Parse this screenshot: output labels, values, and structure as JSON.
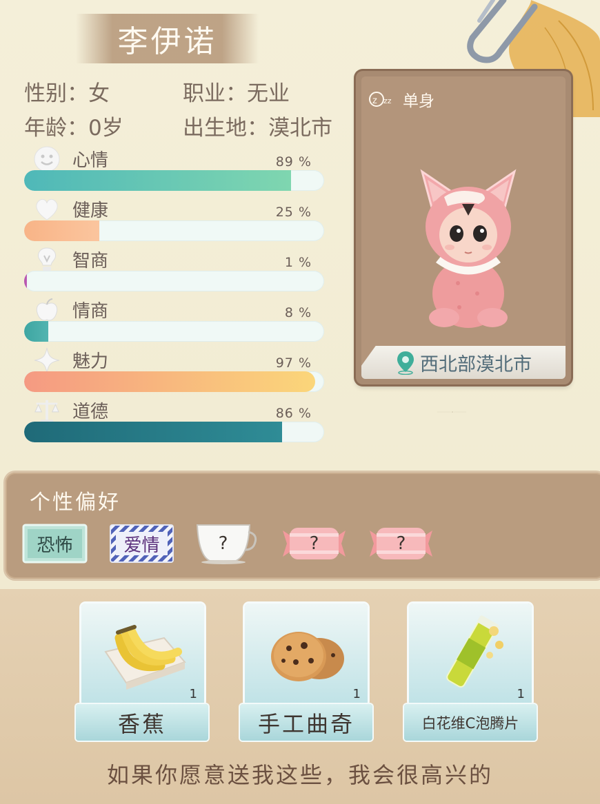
{
  "profile": {
    "name": "李伊诺",
    "gender": "性别：女",
    "job": "职业：无业",
    "age": "年龄：0岁",
    "birthplace": "出生地：漠北市"
  },
  "stats": [
    {
      "label": "心情",
      "percent_text": "89 %",
      "value": 0.89,
      "icon": "smile-icon",
      "color_from": "#4fb8b8",
      "color_to": "#7fd6b0"
    },
    {
      "label": "健康",
      "percent_text": "25 %",
      "value": 0.25,
      "icon": "heart-icon",
      "color_from": "#f8b487",
      "color_to": "#fbc59e"
    },
    {
      "label": "智商",
      "percent_text": "1 %",
      "value": 0.01,
      "icon": "lightbulb-icon",
      "color_from": "#b04fa8",
      "color_to": "#c060b8"
    },
    {
      "label": "情商",
      "percent_text": "8 %",
      "value": 0.08,
      "icon": "apple-icon",
      "color_from": "#3ea6a2",
      "color_to": "#52b4b0"
    },
    {
      "label": "魅力",
      "percent_text": "97 %",
      "value": 0.97,
      "icon": "sparkle-icon",
      "color_from": "#f59a82",
      "color_to": "#fbd67a"
    },
    {
      "label": "道德",
      "percent_text": "86 %",
      "value": 0.86,
      "icon": "scales-icon",
      "color_from": "#1f6a78",
      "color_to": "#2f8c96"
    }
  ],
  "card": {
    "status": "单身",
    "status_icon": "sleep-icon",
    "location": "西北部漠北市",
    "location_icon": "map-pin-icon"
  },
  "preferences": {
    "title": "个性偏好",
    "tags": [
      {
        "label": "恐怖",
        "style": "book"
      },
      {
        "label": "爱情",
        "style": "striped"
      },
      {
        "label": "?",
        "style": "cup"
      },
      {
        "label": "?",
        "style": "candy"
      },
      {
        "label": "?",
        "style": "candy"
      }
    ]
  },
  "gifts": [
    {
      "name": "香蕉",
      "count": "1",
      "icon": "banana-icon"
    },
    {
      "name": "手工曲奇",
      "count": "1",
      "icon": "cookie-icon"
    },
    {
      "name": "白花维C泡腾片",
      "count": "1",
      "icon": "vitamin-tube-icon"
    }
  ],
  "footer": {
    "text": "如果你愿意送我这些，我会很高兴的"
  }
}
